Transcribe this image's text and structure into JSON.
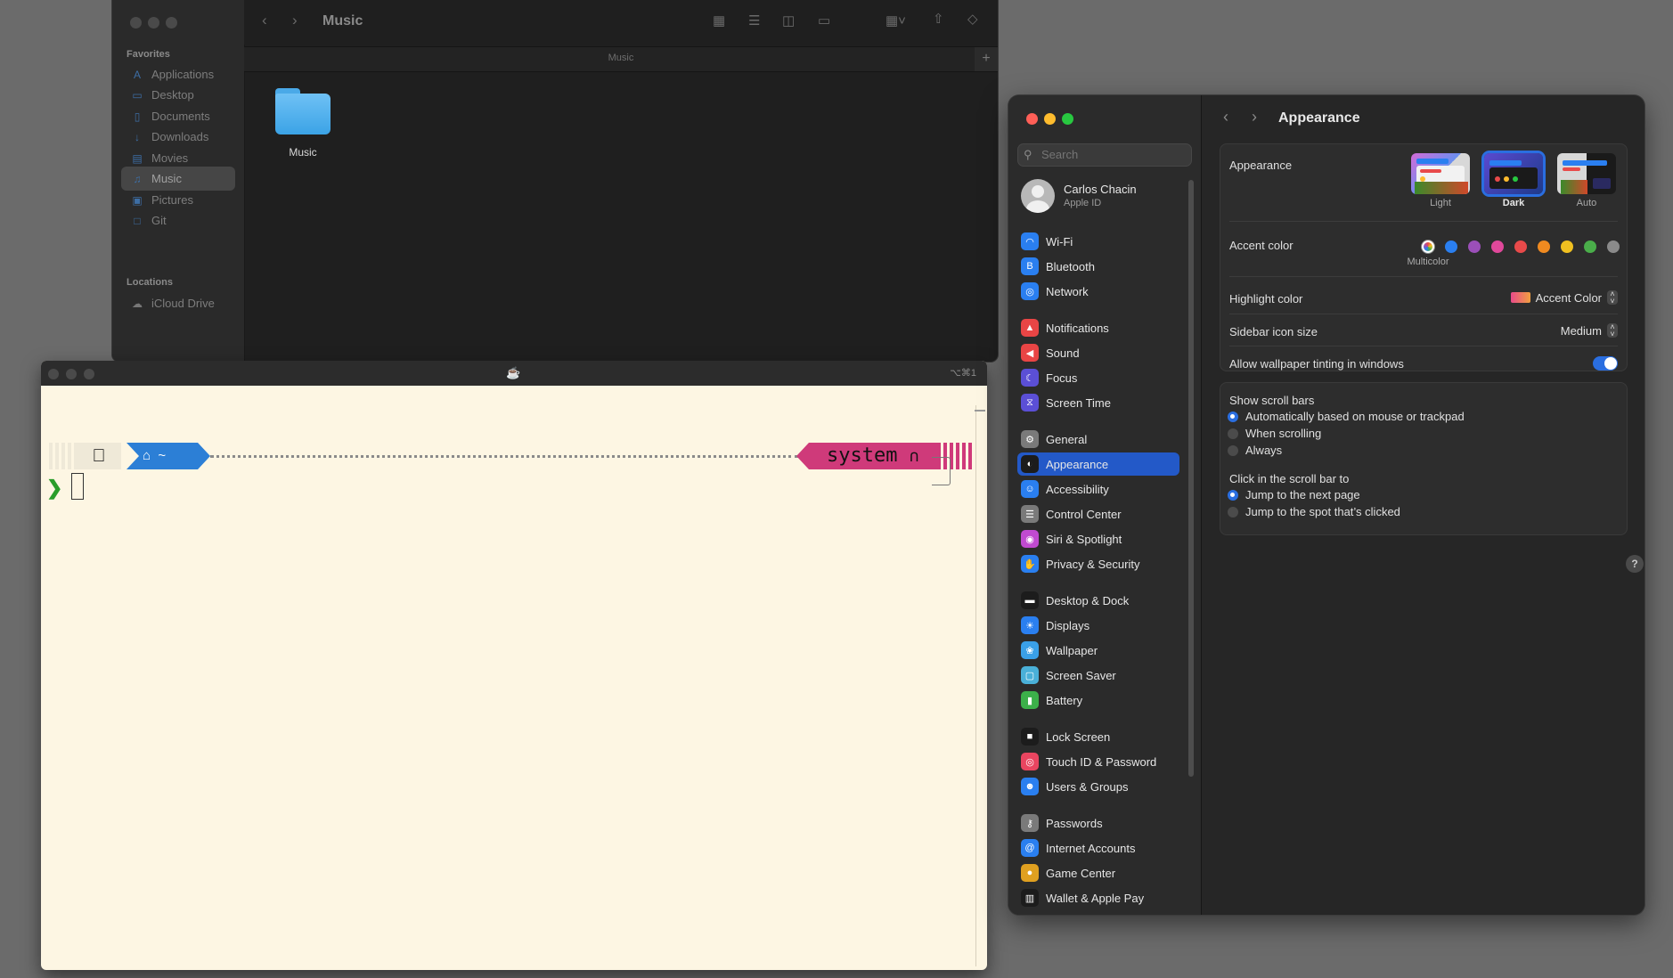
{
  "finder": {
    "title": "Music",
    "path_title": "Music",
    "favorites_label": "Favorites",
    "locations_label": "Locations",
    "favorites": [
      {
        "label": "Applications",
        "icon": "applications-icon"
      },
      {
        "label": "Desktop",
        "icon": "desktop-icon"
      },
      {
        "label": "Documents",
        "icon": "document-icon"
      },
      {
        "label": "Downloads",
        "icon": "download-icon"
      },
      {
        "label": "Movies",
        "icon": "movie-icon"
      },
      {
        "label": "Music",
        "icon": "music-icon",
        "selected": true
      },
      {
        "label": "Pictures",
        "icon": "picture-icon"
      },
      {
        "label": "Git",
        "icon": "folder-icon"
      }
    ],
    "locations": [
      {
        "label": "iCloud Drive",
        "icon": "cloud-icon"
      }
    ],
    "items": [
      {
        "name": "Music",
        "kind": "folder"
      }
    ]
  },
  "terminal": {
    "shortcut": "⌥⌘1",
    "prompt_home": "~",
    "prompt_system": "system",
    "prompt_symbol": "❯"
  },
  "settings": {
    "search_placeholder": "Search",
    "user": {
      "name": "Carlos Chacin",
      "subtitle": "Apple ID"
    },
    "page_title": "Appearance",
    "sidebar": [
      {
        "label": "Wi-Fi",
        "icon": "wifi-icon",
        "color": "#2a7ff0"
      },
      {
        "label": "Bluetooth",
        "icon": "bluetooth-icon",
        "color": "#2a7ff0"
      },
      {
        "label": "Network",
        "icon": "network-icon",
        "color": "#2a7ff0"
      },
      {
        "label": "Notifications",
        "icon": "bell-icon",
        "color": "#e94545"
      },
      {
        "label": "Sound",
        "icon": "speaker-icon",
        "color": "#e94545"
      },
      {
        "label": "Focus",
        "icon": "moon-icon",
        "color": "#5b4fd6"
      },
      {
        "label": "Screen Time",
        "icon": "hourglass-icon",
        "color": "#5b4fd6"
      },
      {
        "label": "General",
        "icon": "gear-icon",
        "color": "#7a7a7a"
      },
      {
        "label": "Appearance",
        "icon": "appearance-icon",
        "color": "#1c1c1c",
        "selected": true
      },
      {
        "label": "Accessibility",
        "icon": "accessibility-icon",
        "color": "#2a7ff0"
      },
      {
        "label": "Control Center",
        "icon": "control-center-icon",
        "color": "#7a7a7a"
      },
      {
        "label": "Siri & Spotlight",
        "icon": "siri-icon",
        "color": "#c04ad0"
      },
      {
        "label": "Privacy & Security",
        "icon": "hand-icon",
        "color": "#2a7ff0"
      },
      {
        "label": "Desktop & Dock",
        "icon": "dock-icon",
        "color": "#1c1c1c"
      },
      {
        "label": "Displays",
        "icon": "sun-icon",
        "color": "#2a7ff0"
      },
      {
        "label": "Wallpaper",
        "icon": "wallpaper-icon",
        "color": "#3aa0e8"
      },
      {
        "label": "Screen Saver",
        "icon": "screensaver-icon",
        "color": "#4ab0d8"
      },
      {
        "label": "Battery",
        "icon": "battery-icon",
        "color": "#3cb04a"
      },
      {
        "label": "Lock Screen",
        "icon": "lock-icon",
        "color": "#1c1c1c"
      },
      {
        "label": "Touch ID & Password",
        "icon": "fingerprint-icon",
        "color": "#e94560"
      },
      {
        "label": "Users & Groups",
        "icon": "users-icon",
        "color": "#2a7ff0"
      },
      {
        "label": "Passwords",
        "icon": "key-icon",
        "color": "#7a7a7a"
      },
      {
        "label": "Internet Accounts",
        "icon": "at-icon",
        "color": "#2a7ff0"
      },
      {
        "label": "Game Center",
        "icon": "game-center-icon",
        "color": "#e0a020"
      },
      {
        "label": "Wallet & Apple Pay",
        "icon": "wallet-icon",
        "color": "#1c1c1c"
      }
    ],
    "appearance": {
      "label": "Appearance",
      "options": [
        {
          "label": "Light",
          "selected": false
        },
        {
          "label": "Dark",
          "selected": true
        },
        {
          "label": "Auto",
          "selected": false
        }
      ]
    },
    "accent": {
      "label": "Accent color",
      "selected_name": "Multicolor",
      "colors": [
        "multicolor",
        "#2a7ff0",
        "#9b4fb8",
        "#e0489a",
        "#e84a4a",
        "#f08a20",
        "#f0c020",
        "#4aae4a",
        "#8a8a8a"
      ]
    },
    "highlight": {
      "label": "Highlight color",
      "value": "Accent Color"
    },
    "sidebar_icon_size": {
      "label": "Sidebar icon size",
      "value": "Medium"
    },
    "wallpaper_tinting": {
      "label": "Allow wallpaper tinting in windows",
      "on": true
    },
    "scroll_bars": {
      "label": "Show scroll bars",
      "options": [
        {
          "label": "Automatically based on mouse or trackpad",
          "selected": true
        },
        {
          "label": "When scrolling",
          "selected": false
        },
        {
          "label": "Always",
          "selected": false
        }
      ]
    },
    "click_scroll": {
      "label": "Click in the scroll bar to",
      "options": [
        {
          "label": "Jump to the next page",
          "selected": true
        },
        {
          "label": "Jump to the spot that’s clicked",
          "selected": false
        }
      ]
    },
    "help": "?"
  }
}
